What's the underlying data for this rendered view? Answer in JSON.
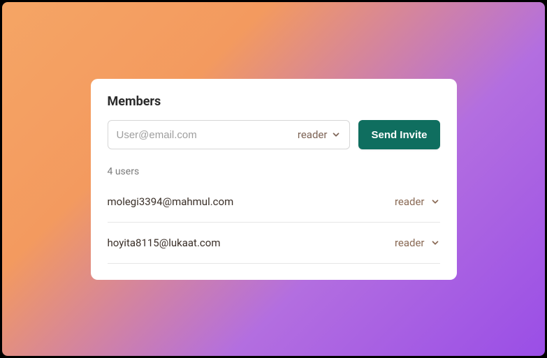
{
  "panel": {
    "title": "Members",
    "invite": {
      "placeholder": "User@email.com",
      "role": "reader",
      "button": "Send Invite"
    },
    "count_text": "4 users",
    "members": [
      {
        "email": "molegi3394@mahmul.com",
        "role": "reader"
      },
      {
        "email": "hoyita8115@lukaat.com",
        "role": "reader"
      }
    ]
  }
}
